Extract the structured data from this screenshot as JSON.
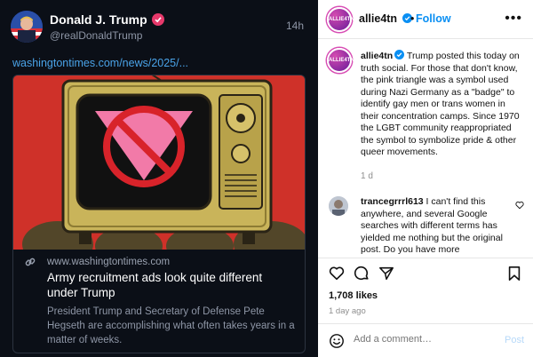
{
  "truth_post": {
    "author_name": "Donald J. Trump",
    "author_handle": "@realDonaldTrump",
    "time": "14h",
    "link_text": "washingtontimes.com/news/2025/...",
    "card": {
      "domain": "www.washingtontimes.com",
      "title": "Army recruitment ads look quite different under Trump",
      "description": "President Trump and Secretary of Defense Pete Hegseth are accomplishing what often takes years in a matter of weeks."
    }
  },
  "instagram": {
    "header": {
      "username": "allie4tn",
      "separator": "•",
      "follow_label": "Follow",
      "more_label": "•••"
    },
    "avatar_text": "ALLIE4TN",
    "caption": {
      "username": "allie4tn",
      "text": "Trump posted this today on truth social. For those that don't know, the pink triangle was a symbol used during Nazi Germany as a \"badge\" to identify gay men or trans women in their concentration camps. Since 1970 the LGBT community reappropriated the symbol to symbolize pride & other queer movements.",
      "time": "1 d"
    },
    "comment": {
      "username": "trancegrrrl613",
      "text": "I can't find this anywhere, and several Google searches with different terms has yielded me nothing but the original post. Do you have more"
    },
    "likes": "1,708 likes",
    "posted_ago": "1 day ago",
    "add_comment_placeholder": "Add a comment…",
    "post_label": "Post"
  },
  "colors": {
    "follow_blue": "#0a8ff3",
    "link_blue": "#4aa3e8",
    "truth_bg": "#0b0f17",
    "card_red": "#cf3129",
    "pink_triangle": "#f27aa8"
  }
}
